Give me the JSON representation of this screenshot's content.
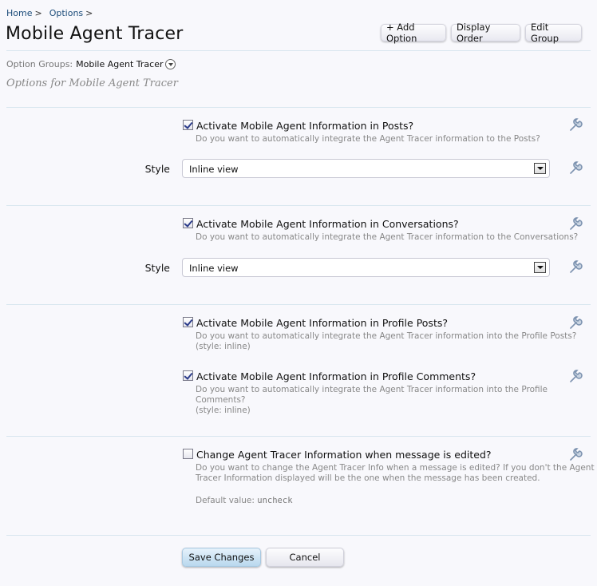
{
  "breadcrumb": {
    "home": "Home",
    "options": "Options",
    "separator": ">"
  },
  "page": {
    "title": "Mobile Agent Tracer",
    "subtitle": "Options for Mobile Agent Tracer"
  },
  "toolbar": {
    "add_option": "+ Add Option",
    "display_order": "Display Order",
    "edit_group": "Edit Group"
  },
  "option_groups": {
    "label": "Option Groups:",
    "value": "Mobile Agent Tracer"
  },
  "options": [
    {
      "label": "Activate Mobile Agent Information in Posts?",
      "description": "Do you want to automatically integrate the Agent Tracer information to the Posts?",
      "checked": true
    },
    {
      "label": "Activate Mobile Agent Information in Conversations?",
      "description": "Do you want to automatically integrate the Agent Tracer information to the Conversations?",
      "checked": true
    },
    {
      "label": "Activate Mobile Agent Information in Profile Posts?",
      "description_line1": "Do you want to automatically integrate the Agent Tracer information into the Profile Posts?",
      "description_line2": "(style: inline)",
      "checked": true
    },
    {
      "label": "Activate Mobile Agent Information in Profile Comments?",
      "description_line1": "Do you want to automatically integrate the Agent Tracer information into the Profile Comments?",
      "description_line2": "(style: inline)",
      "checked": true
    },
    {
      "label": "Change Agent Tracer Information when message is edited?",
      "description_line1": "Do you want to change the Agent Tracer Info when a message is edited? If you don't the Agent",
      "description_line2": "Tracer Information displayed will be the one when the message has been created.",
      "checked": false,
      "default_label": "Default value:",
      "default_value": "uncheck"
    }
  ],
  "style_selects": [
    {
      "label": "Style",
      "value": "Inline view"
    },
    {
      "label": "Style",
      "value": "Inline view"
    }
  ],
  "icons": {
    "wrench": "wrench-icon",
    "dropdown": "chevron-down-icon"
  },
  "form": {
    "save": "Save Changes",
    "cancel": "Cancel"
  },
  "colors": {
    "background": "#f8f8fc",
    "link": "#1c4c7a",
    "divider": "#d8e6ef",
    "primary_button": "#b9d8ee"
  }
}
